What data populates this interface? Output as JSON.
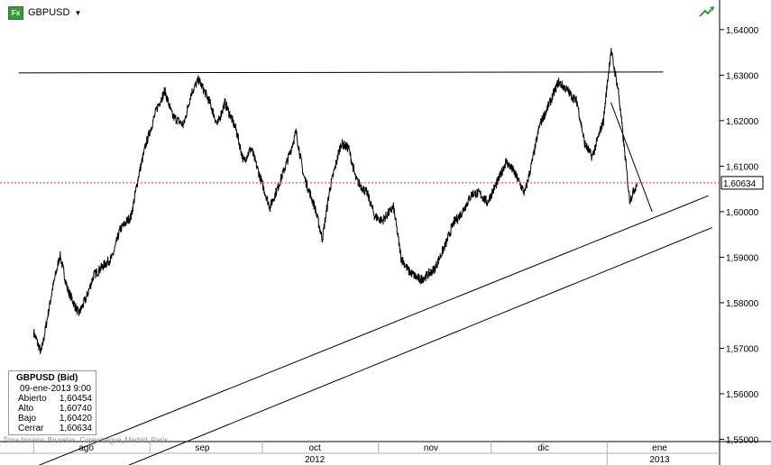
{
  "header": {
    "symbol": "GBPUSD",
    "icon": "fx-icon",
    "dropdown_icon": "caret-down-icon",
    "trend_icon": "trend-arrow-icon"
  },
  "infobox": {
    "title": "GBPUSD (Bid)",
    "datetime": "09-ene-2013 9:00",
    "rows": [
      {
        "label": "Abierto",
        "value": "1,60454"
      },
      {
        "label": "Alto",
        "value": "1,60740"
      },
      {
        "label": "Bajo",
        "value": "1,60420"
      },
      {
        "label": "Cerrar",
        "value": "1,60634"
      }
    ]
  },
  "timezone": "Zona horaria: Bruselas, Copenhague, Madrid, París",
  "colors": {
    "price": "#000000",
    "current_line": "#e0307a",
    "price_tag_border": "#000000",
    "icon_green": "#3a9a3a"
  },
  "chart_data": {
    "type": "line",
    "title": "GBPUSD",
    "ylim": [
      1.5495,
      1.6465
    ],
    "y_ticks": [
      "1,55000",
      "1,56000",
      "1,57000",
      "1,58000",
      "1,59000",
      "1,60000",
      "1,61000",
      "1,62000",
      "1,63000",
      "1,64000"
    ],
    "y_tick_values": [
      1.55,
      1.56,
      1.57,
      1.58,
      1.59,
      1.6,
      1.61,
      1.62,
      1.63,
      1.64
    ],
    "x_months": [
      "ago",
      "sep",
      "oct",
      "nov",
      "dic",
      "ene"
    ],
    "x_years": [
      "2012",
      "2013"
    ],
    "current_price": 1.60634,
    "current_price_label": "1,60634",
    "series": [
      {
        "x": [
          "2012-08-01",
          "2012-08-03",
          "2012-08-06",
          "2012-08-08",
          "2012-08-10",
          "2012-08-13",
          "2012-08-15",
          "2012-08-17",
          "2012-08-20",
          "2012-08-22",
          "2012-08-24",
          "2012-08-27",
          "2012-08-29",
          "2012-08-31",
          "2012-09-03",
          "2012-09-05",
          "2012-09-07",
          "2012-09-10",
          "2012-09-12",
          "2012-09-14",
          "2012-09-17",
          "2012-09-19",
          "2012-09-21",
          "2012-09-24",
          "2012-09-26",
          "2012-09-28",
          "2012-10-01",
          "2012-10-03",
          "2012-10-05",
          "2012-10-08",
          "2012-10-10",
          "2012-10-12",
          "2012-10-15",
          "2012-10-17",
          "2012-10-19",
          "2012-10-22",
          "2012-10-24",
          "2012-10-26",
          "2012-10-29",
          "2012-10-31",
          "2012-11-02",
          "2012-11-05",
          "2012-11-07",
          "2012-11-09",
          "2012-11-12",
          "2012-11-14",
          "2012-11-16",
          "2012-11-19",
          "2012-11-21",
          "2012-11-23",
          "2012-11-26",
          "2012-11-28",
          "2012-11-30",
          "2012-12-03",
          "2012-12-05",
          "2012-12-07",
          "2012-12-10",
          "2012-12-12",
          "2012-12-14",
          "2012-12-17",
          "2012-12-19",
          "2012-12-21",
          "2012-12-24",
          "2012-12-26",
          "2012-12-28",
          "2012-12-31",
          "2013-01-02",
          "2013-01-04",
          "2013-01-07",
          "2013-01-09"
        ],
        "y": [
          1.5735,
          1.569,
          1.583,
          1.5905,
          1.583,
          1.5775,
          1.581,
          1.586,
          1.5885,
          1.59,
          1.596,
          1.599,
          1.608,
          1.615,
          1.623,
          1.6265,
          1.621,
          1.619,
          1.626,
          1.629,
          1.624,
          1.619,
          1.624,
          1.618,
          1.611,
          1.614,
          1.606,
          1.601,
          1.605,
          1.612,
          1.6175,
          1.608,
          1.601,
          1.594,
          1.605,
          1.615,
          1.614,
          1.607,
          1.604,
          1.599,
          1.598,
          1.601,
          1.59,
          1.587,
          1.585,
          1.586,
          1.5875,
          1.593,
          1.5975,
          1.5995,
          1.604,
          1.604,
          1.602,
          1.607,
          1.611,
          1.609,
          1.604,
          1.611,
          1.619,
          1.6245,
          1.6285,
          1.627,
          1.624,
          1.615,
          1.612,
          1.62,
          1.6355,
          1.6265,
          1.6025,
          1.6063
        ]
      }
    ],
    "trendlines": [
      {
        "from": [
          "2012-07-28",
          1.6305
        ],
        "to": [
          "2013-01-16",
          1.6307
        ]
      },
      {
        "from": [
          "2012-07-31",
          1.5435
        ],
        "to": [
          "2013-01-28",
          1.6035
        ]
      },
      {
        "from": [
          "2012-08-12",
          1.5395
        ],
        "to": [
          "2013-01-29",
          1.5965
        ]
      },
      {
        "from": [
          "2013-01-02",
          1.624
        ],
        "to": [
          "2013-01-13",
          1.6
        ]
      }
    ]
  }
}
